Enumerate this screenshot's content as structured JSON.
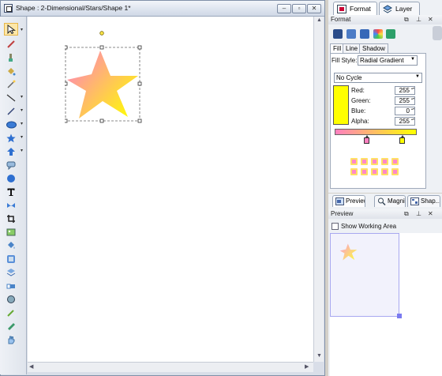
{
  "document": {
    "title": "Shape : 2-Dimensional/Stars/Shape 1*",
    "controls": {
      "minimize": "–",
      "restore": "▫",
      "close": "✕"
    }
  },
  "toolbar": {
    "tools": [
      "selection-arrow-icon",
      "pen-icon",
      "brush-icon",
      "paint-bucket-icon",
      "wand-icon",
      "line-icon",
      "pencil-icon",
      "ellipse-icon",
      "star-icon",
      "arrow-up-icon",
      "callout-icon",
      "balloon-icon",
      "text-icon",
      "ribbon-icon",
      "crop-icon",
      "image-icon",
      "fill-icon",
      "gradient-icon",
      "layers-icon",
      "eraser-icon",
      "stamp-icon",
      "eyedropper-icon",
      "ruler-icon",
      "hand-icon"
    ]
  },
  "canvas": {
    "shape": {
      "type": "star",
      "gradient_colors": [
        "#ff80c0",
        "#ffff00"
      ],
      "selected": true
    }
  },
  "format_panel": {
    "tabs": [
      {
        "label": "Format",
        "icon": "format-icon"
      },
      {
        "label": "Layer",
        "icon": "layer-icon"
      }
    ],
    "header": "Format",
    "subtabs": [
      "Fill",
      "Line",
      "Shadow"
    ],
    "fill_style_label": "Fill Style:",
    "fill_style_value": "Radial Gradient",
    "cycle_value": "No Cycle",
    "color": {
      "red_label": "Red:",
      "red": "255",
      "green_label": "Green:",
      "green": "255",
      "blue_label": "Blue:",
      "blue": "0",
      "alpha_label": "Alpha:",
      "alpha": "255",
      "swatch": "#ffff00"
    },
    "gradient": {
      "start": "#ff80c0",
      "end": "#ffff00"
    }
  },
  "bottom_panel": {
    "tabs": [
      {
        "label": "Preview",
        "icon": "preview-icon"
      },
      {
        "label": "Magni...",
        "icon": "magnifier-icon"
      },
      {
        "label": "Shap...",
        "icon": "shapes-icon"
      }
    ],
    "header": "Preview",
    "show_working_area": "Show Working Area"
  }
}
